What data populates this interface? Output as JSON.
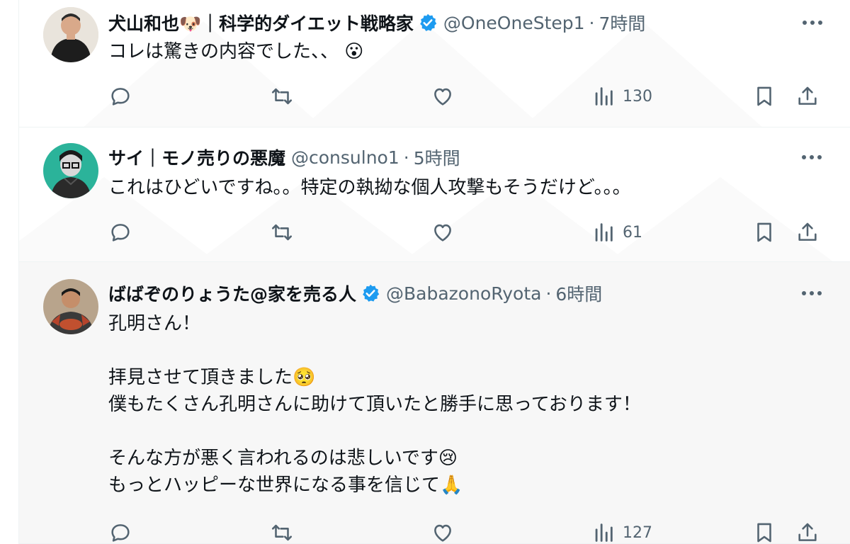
{
  "tweets": [
    {
      "name": "犬山和也🐶｜科学的ダイエット戦略家",
      "verified": true,
      "handle": "@OneOneStep1",
      "separator": "·",
      "time": "7時間",
      "text": "コレは驚きの内容でした、、 😮",
      "views": "130"
    },
    {
      "name": "サイ｜モノ売りの悪魔",
      "verified": false,
      "handle": "@consulno1",
      "separator": "·",
      "time": "5時間",
      "text": "これはひどいですね。。特定の執拗な個人攻撃もそうだけど。。。",
      "views": "61"
    },
    {
      "name": "ばばぞのりょうた@家を売る人",
      "verified": true,
      "handle": "@BabazonoRyota",
      "separator": "·",
      "time": "6時間",
      "text": "孔明さん！\n\n拝見させて頂きました🥺\n僕もたくさん孔明さんに助けて頂いたと勝手に思っております！\n\nそんな方が悪く言われるのは悲しいです😢\nもっとハッピーな世界になる事を信じて🙏",
      "views": "127"
    }
  ],
  "icons": {
    "reply": "reply-icon",
    "retweet": "retweet-icon",
    "like": "like-icon",
    "views": "views-icon",
    "bookmark": "bookmark-icon",
    "share": "share-icon",
    "more": "more-icon",
    "verified": "verified-badge-icon"
  },
  "colors": {
    "text": "#0f1419",
    "secondary": "#536471",
    "verified": "#1d9bf0",
    "highlight_bg": "#f7f7f7"
  }
}
